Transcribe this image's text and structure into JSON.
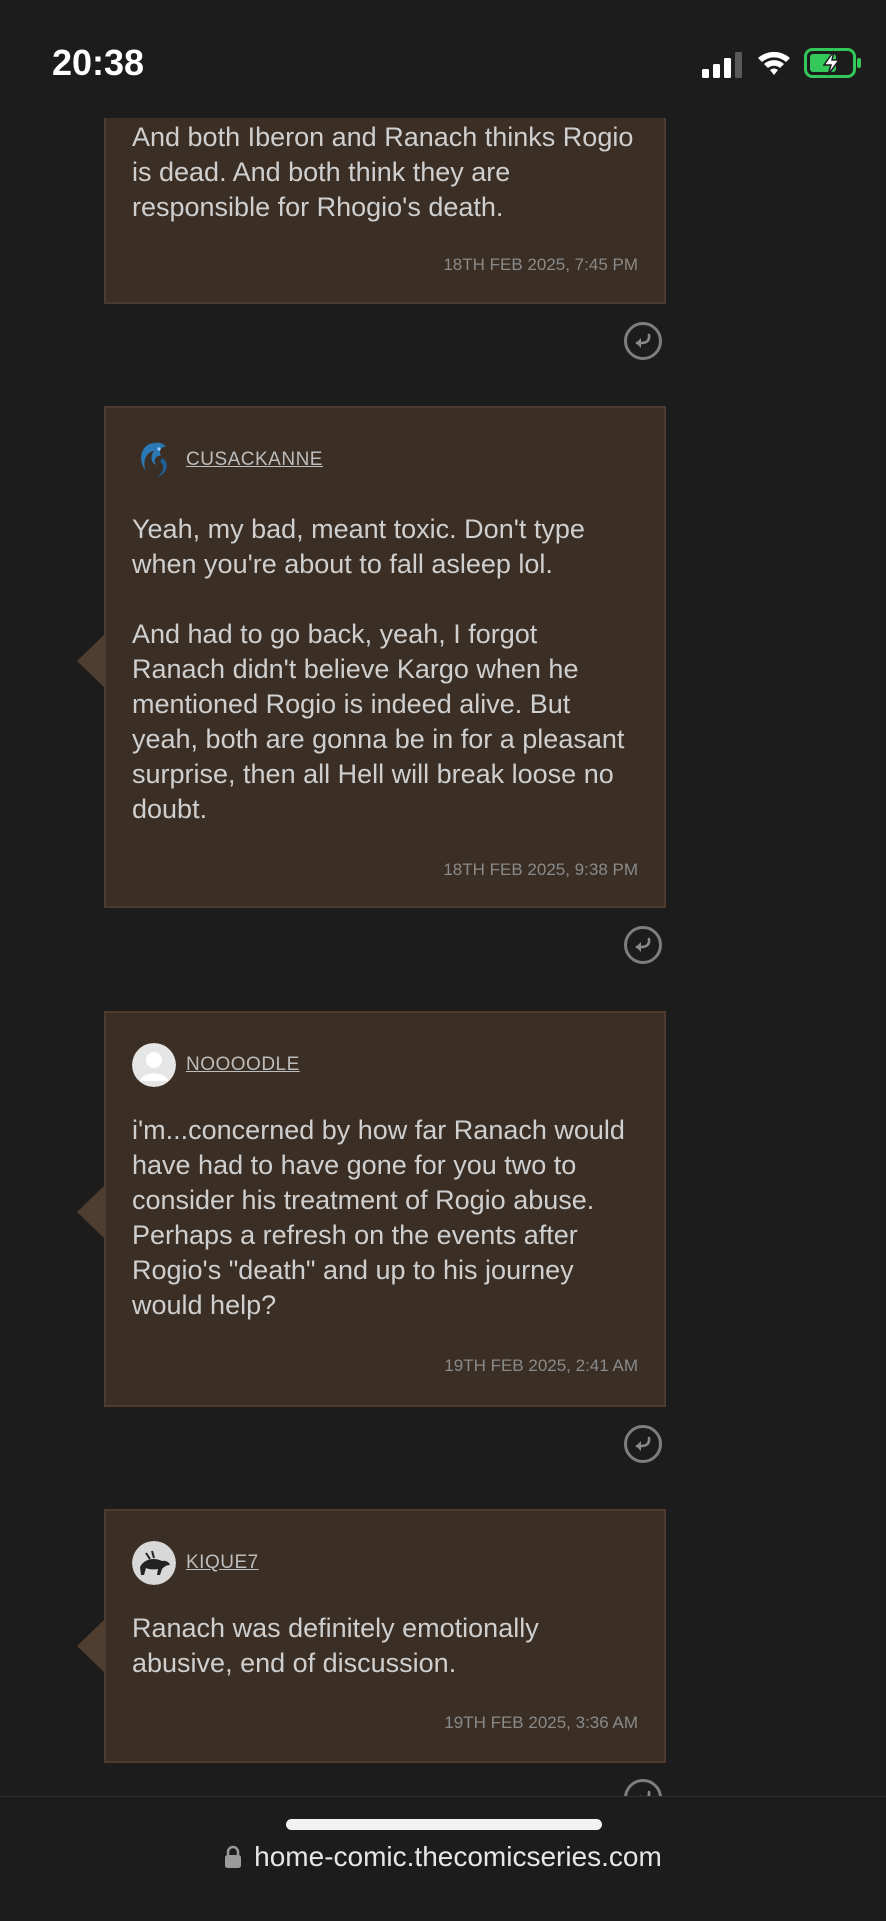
{
  "status_bar": {
    "time": "20:38"
  },
  "comments": [
    {
      "id": "c0",
      "author": "",
      "text": "And both Iberon and Ranach thinks Rogio is dead. And both think they are responsible for Rhogio's death.",
      "timestamp": "18TH FEB 2025, 7:45 PM"
    },
    {
      "id": "c1",
      "author": "CUSACKANNE",
      "avatar": "blue-dragon-avatar",
      "text": "Yeah, my bad, meant toxic. Don't type when you're about to fall asleep lol.\n\nAnd had to go back, yeah, I forgot Ranach didn't believe Kargo when he mentioned Rogio is indeed alive. But yeah, both are gonna be in for a pleasant surprise, then all Hell will break loose no doubt.",
      "timestamp": "18TH FEB 2025, 9:38 PM"
    },
    {
      "id": "c2",
      "author": "NOOOODLE",
      "avatar": "default-user-avatar",
      "text": "i'm...concerned by how far Ranach would have had to have gone for you two to consider his treatment of Rogio abuse. Perhaps a refresh on the events after Rogio's \"death\" and up to his journey would help?",
      "timestamp": "19TH FEB 2025, 2:41 AM"
    },
    {
      "id": "c3",
      "author": "KIQUE7",
      "avatar": "animal-sketch-avatar",
      "text": "Ranach was definitely emotionally abusive, end of discussion.",
      "timestamp": "19TH FEB 2025, 3:36 AM"
    }
  ],
  "browser": {
    "url": "home-comic.thecomicseries.com"
  },
  "colors": {
    "card_background": "#3a2e25",
    "card_border": "#4c3b2e",
    "page_background": "#1c1c1c",
    "battery_green": "#34c759"
  },
  "icons": [
    "reply-icon",
    "lock-icon",
    "signal-icon",
    "wifi-icon",
    "battery-charging-icon"
  ]
}
